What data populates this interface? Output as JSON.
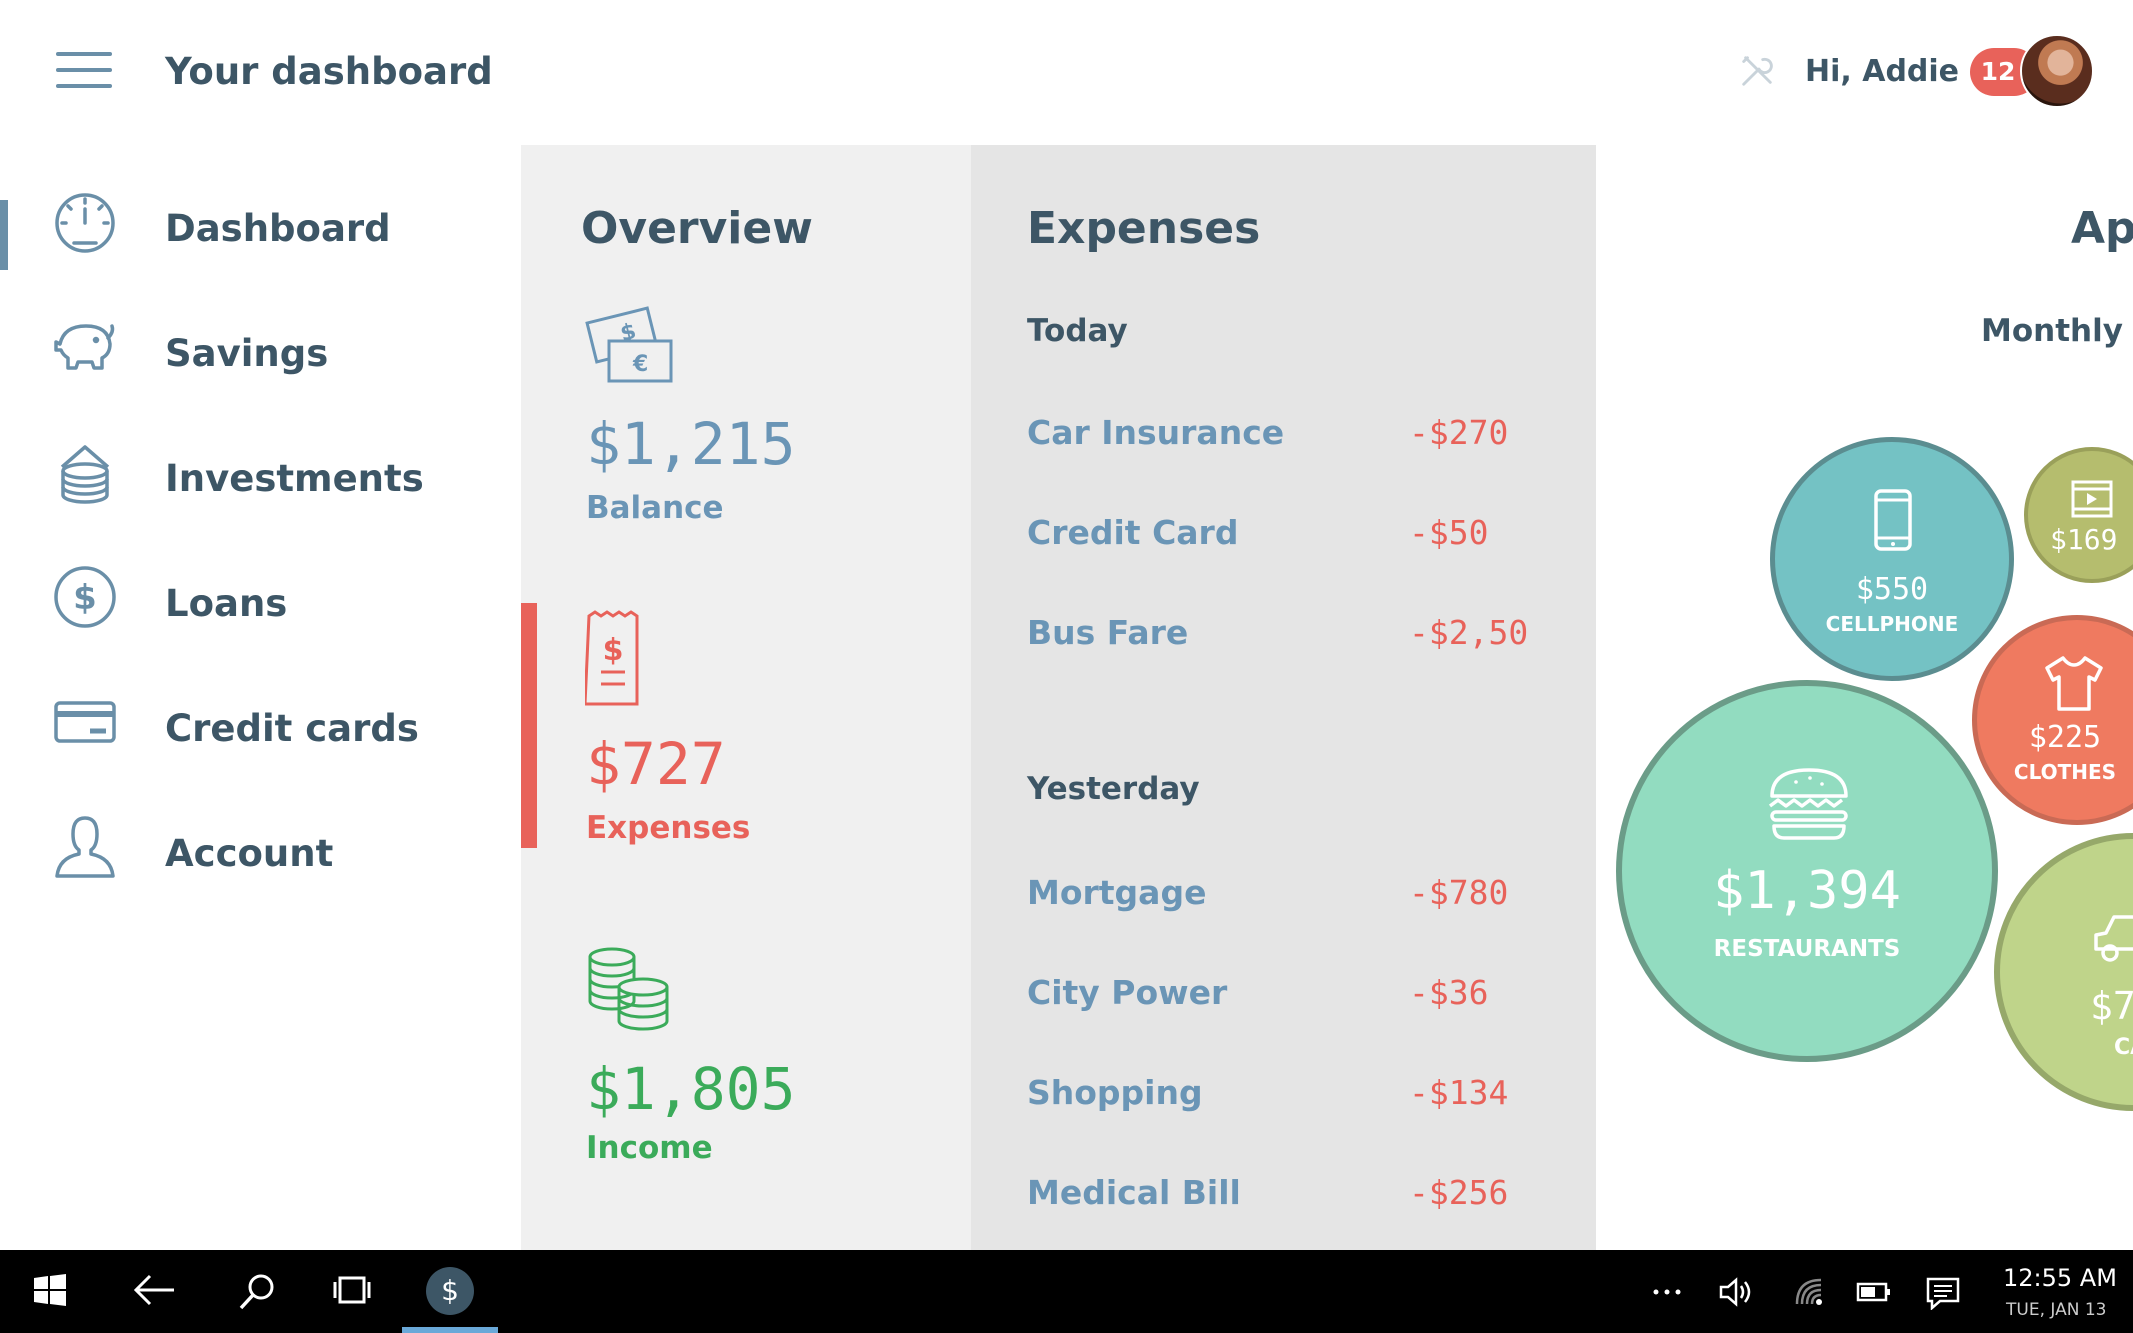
{
  "header": {
    "title": "Your dashboard",
    "greeting": "Hi, Addie",
    "notification_count": "12"
  },
  "sidebar": {
    "items": [
      {
        "label": "Dashboard",
        "icon": "speedometer-icon",
        "active": true
      },
      {
        "label": "Savings",
        "icon": "piggy-bank-icon"
      },
      {
        "label": "Investments",
        "icon": "coin-stack-icon"
      },
      {
        "label": "Loans",
        "icon": "dollar-coin-icon"
      },
      {
        "label": "Credit cards",
        "icon": "credit-card-icon"
      },
      {
        "label": "Account",
        "icon": "person-icon"
      }
    ]
  },
  "overview": {
    "title": "Overview",
    "balance": {
      "amount": "$1,215",
      "label": "Balance",
      "color": "#6a95b6"
    },
    "expenses": {
      "amount": "$727",
      "label": "Expenses",
      "color": "#e8625a"
    },
    "income": {
      "amount": "$1,805",
      "label": "Income",
      "color": "#3bab5a"
    }
  },
  "expenses": {
    "title": "Expenses",
    "today": {
      "label": "Today",
      "items": [
        {
          "name": "Car Insurance",
          "amount": "-$270"
        },
        {
          "name": "Credit Card",
          "amount": "-$50"
        },
        {
          "name": "Bus Fare",
          "amount": "-$2,50"
        }
      ]
    },
    "yesterday": {
      "label": "Yesterday",
      "items": [
        {
          "name": "Mortgage",
          "amount": "-$780"
        },
        {
          "name": "City Power",
          "amount": "-$36"
        },
        {
          "name": "Shopping",
          "amount": "-$134"
        },
        {
          "name": "Medical Bill",
          "amount": "-$256"
        }
      ]
    }
  },
  "apps_panel": {
    "title": "Ap",
    "subtitle": "Monthly S",
    "bubbles": [
      {
        "amount": "$550",
        "category": "CELLPHONE",
        "icon": "phone-icon",
        "color": "#74c2c4"
      },
      {
        "amount": "$169",
        "category": "",
        "icon": "film-icon",
        "color": "#b5bd6e"
      },
      {
        "amount": "$225",
        "category": "CLOTHES",
        "icon": "shirt-icon",
        "color": "#ef7a60"
      },
      {
        "amount": "$1,394",
        "category": "RESTAURANTS",
        "icon": "burger-icon",
        "color": "#92dcc0"
      },
      {
        "amount": "$7",
        "category": "CA",
        "icon": "car-icon",
        "color": "#bfd48a"
      }
    ]
  },
  "taskbar": {
    "time": "12:55 AM",
    "date": "TUE, JAN 13",
    "app_glyph": "$"
  }
}
